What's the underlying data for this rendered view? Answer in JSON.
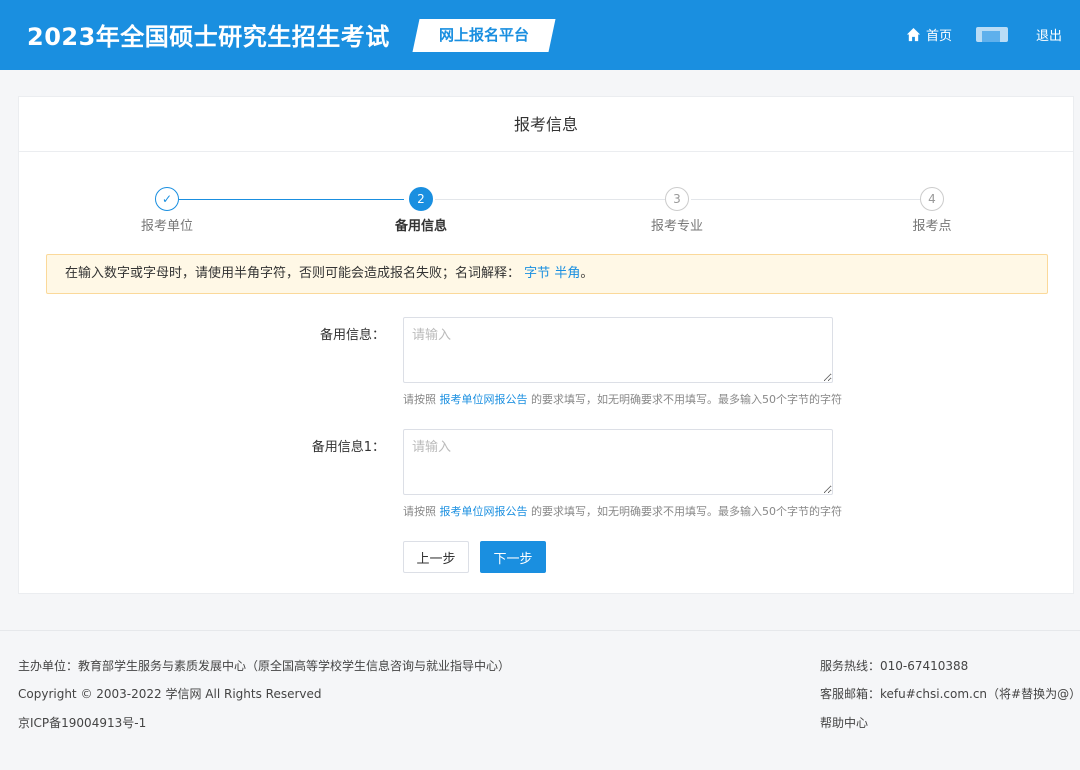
{
  "header": {
    "title": "2023年全国硕士研究生招生考试",
    "badge": "网上报名平台",
    "home": "首页",
    "logout": "退出"
  },
  "card": {
    "title": "报考信息"
  },
  "steps": [
    {
      "num": "✓",
      "label": "报考单位",
      "state": "finished"
    },
    {
      "num": "2",
      "label": "备用信息",
      "state": "active"
    },
    {
      "num": "3",
      "label": "报考专业",
      "state": "pending"
    },
    {
      "num": "4",
      "label": "报考点",
      "state": "pending"
    }
  ],
  "notice": {
    "text": "在输入数字或字母时，请使用半角字符，否则可能会造成报名失败；名词解释：",
    "link1": "字节",
    "link2": "半角",
    "end": "。"
  },
  "form": {
    "field1": {
      "label": "备用信息：",
      "placeholder": "请输入",
      "value": "",
      "hint_prefix": "请按照",
      "hint_link": "报考单位网报公告",
      "hint_suffix": "的要求填写，如无明确要求不用填写。最多输入50个字节的字符"
    },
    "field2": {
      "label": "备用信息1：",
      "placeholder": "请输入",
      "value": "",
      "hint_prefix": "请按照",
      "hint_link": "报考单位网报公告",
      "hint_suffix": "的要求填写，如无明确要求不用填写。最多输入50个字节的字符"
    },
    "prev": "上一步",
    "next": "下一步"
  },
  "footer": {
    "sponsor": "主办单位：教育部学生服务与素质发展中心（原全国高等学校学生信息咨询与就业指导中心）",
    "copyright": "Copyright © 2003-2022 学信网 All Rights Reserved",
    "icp": "京ICP备19004913号-1",
    "hotline": "服务热线：010-67410388",
    "email": "客服邮箱：kefu#chsi.com.cn（将#替换为@）",
    "help": "帮助中心"
  },
  "colors": {
    "primary": "#1a8fe0",
    "notice_bg": "#fff8e6",
    "notice_border": "#fbd99a"
  }
}
